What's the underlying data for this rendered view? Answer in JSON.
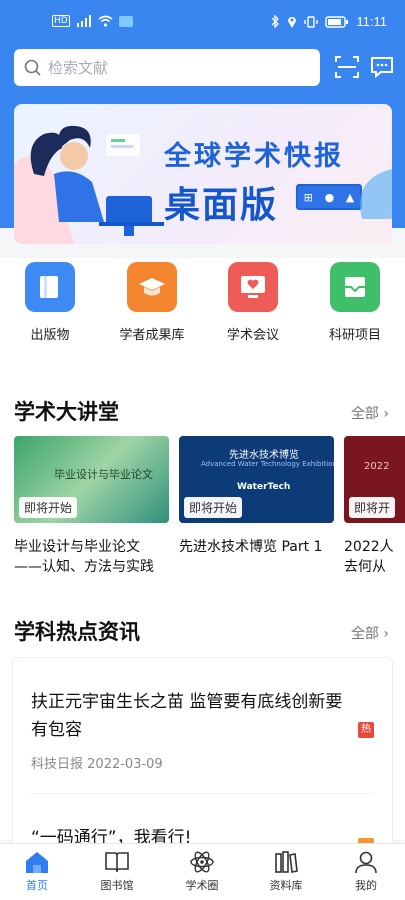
{
  "status_bar": {
    "time": "11:11"
  },
  "search": {
    "placeholder": "检索文献"
  },
  "banner": {
    "title_line1": "全球学术快报",
    "title_line2": "桌面版"
  },
  "quick_entries": [
    {
      "label": "出版物",
      "color": "#3d8bf2",
      "icon": "book-icon"
    },
    {
      "label": "学者成果库",
      "color": "#f2852e",
      "icon": "graduation-cap-icon"
    },
    {
      "label": "学术会议",
      "color": "#ef5b56",
      "icon": "monitor-heart-icon"
    },
    {
      "label": "科研项目",
      "color": "#3fbf6a",
      "icon": "inbox-icon"
    }
  ],
  "lectures": {
    "title": "学术大讲堂",
    "more": "全部",
    "items": [
      {
        "badge": "即将开始",
        "title_line1": "毕业设计与毕业论文",
        "title_line2": "——认知、方法与实践",
        "thumb_text": "毕业设计与毕业论文"
      },
      {
        "badge": "即将开始",
        "title_line1": "先进水技术博览  Part 1",
        "title_line2": "",
        "thumb_text": "先进水技术博览",
        "thumb_sub": "Advanced Water Technology Exhibition",
        "thumb_brand": "WaterTech"
      },
      {
        "badge": "即将开",
        "title_line1": "2022人",
        "title_line2": "去何从",
        "thumb_text": "2022"
      }
    ]
  },
  "hot_news": {
    "title": "学科热点资讯",
    "more": "全部",
    "items": [
      {
        "title": "扶正元宇宙生长之苗  监管要有底线创新要有包容",
        "tag": "热",
        "source": "科技日报",
        "date": "2022-03-09"
      },
      {
        "title": "“一码通行”，我看行!"
      }
    ]
  },
  "tabbar": [
    {
      "label": "首页",
      "icon": "home-icon",
      "active": true
    },
    {
      "label": "图书馆",
      "icon": "open-book-icon",
      "active": false
    },
    {
      "label": "学术圈",
      "icon": "atom-icon",
      "active": false
    },
    {
      "label": "资料库",
      "icon": "library-shelf-icon",
      "active": false
    },
    {
      "label": "我的",
      "icon": "user-icon",
      "active": false
    }
  ]
}
